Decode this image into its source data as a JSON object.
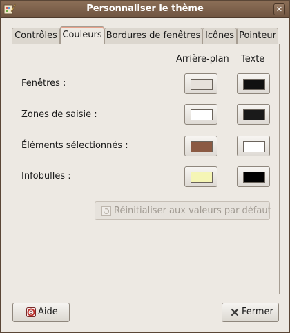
{
  "window": {
    "title": "Personnaliser le thème",
    "close_glyph": "✕",
    "app_icon": "theme-icon"
  },
  "tabs": [
    {
      "label": "Contrôles",
      "active": false
    },
    {
      "label": "Couleurs",
      "active": true
    },
    {
      "label": "Bordures de fenêtres",
      "active": false
    },
    {
      "label": "Icônes",
      "active": false
    },
    {
      "label": "Pointeur",
      "active": false
    }
  ],
  "colors": {
    "headers": {
      "background": "Arrière-plan",
      "text": "Texte"
    },
    "rows": [
      {
        "label": "Fenêtres :",
        "background": "#ede9e3",
        "text": "#111111"
      },
      {
        "label": "Zones de saisie :",
        "background": "#ffffff",
        "text": "#1a1a1a"
      },
      {
        "label": "Éléments sélectionnés :",
        "background": "#8b5a43",
        "text": "#ffffff"
      },
      {
        "label": "Infobulles :",
        "background": "#f5f5b5",
        "text": "#000000"
      }
    ],
    "reset_label": "Réinitialiser aux valeurs par défaut",
    "reset_icon": "revert-icon"
  },
  "footer": {
    "help_label": "Aide",
    "help_icon": "help-lifebuoy-icon",
    "close_label": "Fermer",
    "close_icon": "close-icon"
  }
}
